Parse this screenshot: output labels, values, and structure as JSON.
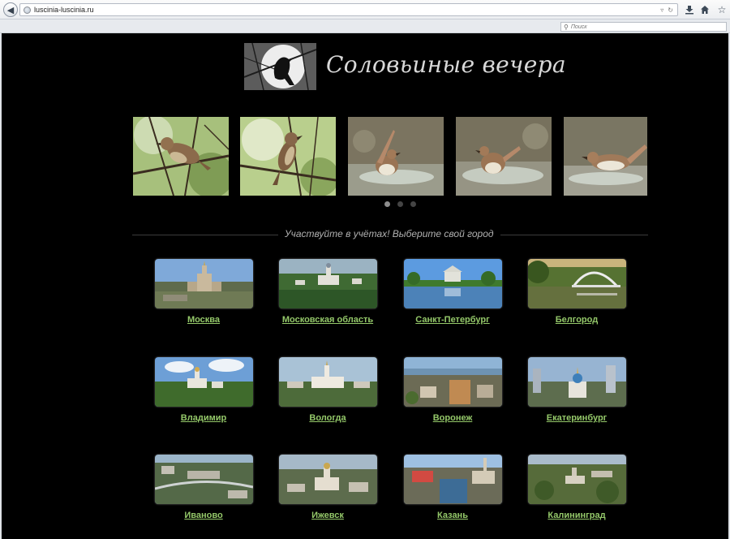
{
  "browser": {
    "url": "luscinia-luscinia.ru",
    "search_placeholder": "Поиск"
  },
  "header": {
    "title": "Соловьиные вечера"
  },
  "slider": {
    "slide_count": 5,
    "dots": 3,
    "active_dot": 0
  },
  "tagline": "Участвуйте в учётах! Выберите свой город",
  "cities": [
    {
      "name": "Москва"
    },
    {
      "name": "Московская область"
    },
    {
      "name": "Санкт-Петербург"
    },
    {
      "name": "Белгород"
    },
    {
      "name": "Владимир"
    },
    {
      "name": "Вологда"
    },
    {
      "name": "Воронеж"
    },
    {
      "name": "Екатеринбург"
    },
    {
      "name": "Иваново"
    },
    {
      "name": "Ижевск"
    },
    {
      "name": "Казань"
    },
    {
      "name": "Калининград"
    }
  ],
  "colors": {
    "background": "#000000",
    "link": "#95c96a",
    "title": "#d8d8d8"
  }
}
